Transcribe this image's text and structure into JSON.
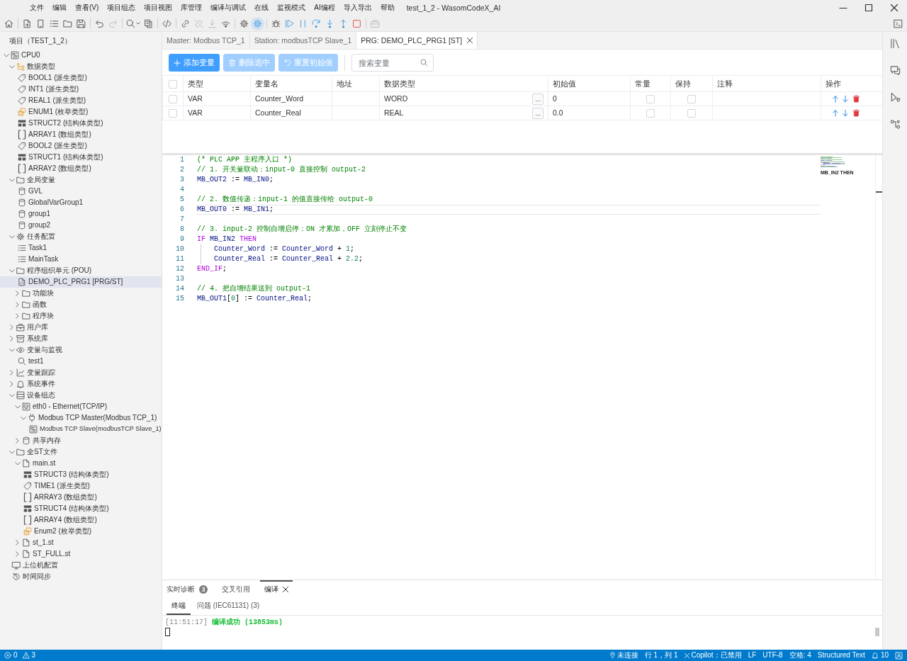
{
  "window": {
    "title": "test_1_2 - WasomCodeX_AI"
  },
  "menu": [
    "文件",
    "编辑",
    "查看(V)",
    "项目组态",
    "项目视图",
    "库管理",
    "编译与调试",
    "在线",
    "监视模式",
    "AI编程",
    "导入导出",
    "帮助"
  ],
  "toolbar": [
    {
      "kind": "home",
      "disabled": false,
      "active": false
    },
    {
      "kind": "separator"
    },
    {
      "kind": "new",
      "disabled": false,
      "active": false
    },
    {
      "kind": "device",
      "disabled": false,
      "active": false
    },
    {
      "kind": "list",
      "disabled": false,
      "active": false
    },
    {
      "kind": "open",
      "disabled": false,
      "active": false
    },
    {
      "kind": "save",
      "disabled": false,
      "active": false
    },
    {
      "kind": "separator"
    },
    {
      "kind": "undo",
      "disabled": false,
      "active": false
    },
    {
      "kind": "redo",
      "disabled": true,
      "active": false
    },
    {
      "kind": "separator"
    },
    {
      "kind": "find",
      "disabled": false,
      "active": false
    },
    {
      "kind": "board",
      "disabled": false,
      "active": false
    },
    {
      "kind": "separator"
    },
    {
      "kind": "code",
      "disabled": false,
      "active": false
    },
    {
      "kind": "separator"
    },
    {
      "kind": "connect",
      "disabled": false,
      "active": false
    },
    {
      "kind": "disconnect",
      "disabled": true,
      "active": false
    },
    {
      "kind": "download",
      "disabled": true,
      "active": false
    },
    {
      "kind": "monitor",
      "disabled": false,
      "active": false
    },
    {
      "kind": "separator"
    },
    {
      "kind": "settings",
      "disabled": false,
      "active": false
    },
    {
      "kind": "simulate",
      "disabled": false,
      "active": true
    },
    {
      "kind": "separator"
    },
    {
      "kind": "debug",
      "disabled": false,
      "active": false
    },
    {
      "kind": "run",
      "disabled": false,
      "active": false
    },
    {
      "kind": "pause",
      "disabled": false,
      "active": false
    },
    {
      "kind": "stepover",
      "disabled": false,
      "active": false
    },
    {
      "kind": "stepinto",
      "disabled": false,
      "active": false
    },
    {
      "kind": "stepout",
      "disabled": false,
      "active": false
    },
    {
      "kind": "stop",
      "disabled": false,
      "active": false
    },
    {
      "kind": "separator"
    },
    {
      "kind": "package",
      "disabled": true,
      "active": false
    },
    {
      "kind": "spacer"
    },
    {
      "kind": "terminal",
      "disabled": false,
      "active": false
    }
  ],
  "sidebar": {
    "title": "项目（TEST_1_2）",
    "tree": [
      {
        "label": "CPU0",
        "kind": "cpu",
        "expanded": true,
        "selected": false,
        "children": [
          {
            "label": "数据类型",
            "kind": "datatypes",
            "expanded": true,
            "selected": false,
            "children": [
              {
                "label": "BOOL1 (派生类型)",
                "kind": "derived",
                "selected": false
              },
              {
                "label": "INT1 (派生类型)",
                "kind": "derived",
                "selected": false
              },
              {
                "label": "REAL1 (派生类型)",
                "kind": "derived",
                "selected": false
              },
              {
                "label": "ENUM1 (枚举类型)",
                "kind": "enum",
                "selected": false
              },
              {
                "label": "STRUCT2 (结构体类型)",
                "kind": "struct",
                "selected": false
              },
              {
                "label": "ARRAY1 (数组类型)",
                "kind": "array",
                "selected": false
              },
              {
                "label": "BOOL2 (派生类型)",
                "kind": "derived",
                "selected": false
              },
              {
                "label": "STRUCT1 (结构体类型)",
                "kind": "struct",
                "selected": false
              },
              {
                "label": "ARRAY2 (数组类型)",
                "kind": "array",
                "selected": false
              }
            ]
          },
          {
            "label": "全局变量",
            "kind": "folder",
            "expanded": true,
            "selected": false,
            "children": [
              {
                "label": "GVL",
                "kind": "varlist",
                "selected": false
              },
              {
                "label": "GlobalVarGroup1",
                "kind": "varlist",
                "selected": false
              },
              {
                "label": "group1",
                "kind": "varlist",
                "selected": false
              },
              {
                "label": "group2",
                "kind": "varlist",
                "selected": false
              }
            ]
          },
          {
            "label": "任务配置",
            "kind": "tasks",
            "expanded": true,
            "selected": false,
            "children": [
              {
                "label": "Task1",
                "kind": "task",
                "selected": false
              },
              {
                "label": "MainTask",
                "kind": "task",
                "selected": false
              }
            ]
          },
          {
            "label": "程序组织单元 (POU)",
            "kind": "folder",
            "expanded": true,
            "selected": false,
            "children": [
              {
                "label": "DEMO_PLC_PRG1 [PRG/ST]",
                "kind": "program",
                "selected": true
              },
              {
                "label": "功能块",
                "kind": "folder",
                "expanded": false,
                "selected": false
              },
              {
                "label": "函数",
                "kind": "folder",
                "expanded": false,
                "selected": false
              },
              {
                "label": "程序块",
                "kind": "folder",
                "expanded": false,
                "selected": false
              }
            ]
          },
          {
            "label": "用户库",
            "kind": "userlib",
            "expanded": false,
            "selected": false
          },
          {
            "label": "系统库",
            "kind": "syslib",
            "expanded": false,
            "selected": false
          },
          {
            "label": "变量与监视",
            "kind": "watch",
            "expanded": true,
            "selected": false,
            "children": [
              {
                "label": "test1",
                "kind": "watchlist",
                "selected": false
              }
            ]
          },
          {
            "label": "变量跟踪",
            "kind": "trace",
            "expanded": false,
            "selected": false
          },
          {
            "label": "系统事件",
            "kind": "events",
            "expanded": false,
            "selected": false
          },
          {
            "label": "设备组态",
            "kind": "devices",
            "expanded": true,
            "selected": false,
            "children": [
              {
                "label": "eth0 - Ethernet(TCP/IP)",
                "kind": "ethernet",
                "expanded": true,
                "selected": false,
                "children": [
                  {
                    "label": "Modbus TCP Master(Modbus TCP_1)",
                    "kind": "master",
                    "expanded": true,
                    "selected": false,
                    "children": [
                      {
                        "label": "Modbus TCP Slave(modbusTCP Slave_1)",
                        "kind": "slave",
                        "selected": false
                      }
                    ]
                  }
                ]
              },
              {
                "label": "共享内存",
                "kind": "memory",
                "expanded": false,
                "selected": false
              }
            ]
          },
          {
            "label": "全ST文件",
            "kind": "folder",
            "expanded": true,
            "selected": false,
            "children": [
              {
                "label": "main.st",
                "kind": "stfile",
                "expanded": true,
                "selected": false,
                "children": [
                  {
                    "label": "STRUCT3 (结构体类型)",
                    "kind": "struct",
                    "selected": false
                  },
                  {
                    "label": "TIME1 (派生类型)",
                    "kind": "derived",
                    "selected": false
                  },
                  {
                    "label": "ARRAY3 (数组类型)",
                    "kind": "array",
                    "selected": false
                  },
                  {
                    "label": "STRUCT4 (结构体类型)",
                    "kind": "struct",
                    "selected": false
                  },
                  {
                    "label": "ARRAY4 (数组类型)",
                    "kind": "array",
                    "selected": false
                  },
                  {
                    "label": "Enum2 (枚举类型)",
                    "kind": "enum",
                    "selected": false
                  }
                ]
              },
              {
                "label": "st_1.st",
                "kind": "stfile",
                "expanded": false,
                "selected": false
              },
              {
                "label": "ST_FULL.st",
                "kind": "stfile",
                "expanded": false,
                "selected": false
              }
            ]
          },
          {
            "label": "上位机配置",
            "kind": "host",
            "selected": false
          },
          {
            "label": "时间同步",
            "kind": "timesync",
            "selected": false
          }
        ]
      }
    ]
  },
  "tabs": [
    {
      "label": "Master: Modbus TCP_1",
      "selected": false
    },
    {
      "label": "Station: modbusTCP Slave_1",
      "selected": false
    },
    {
      "label": "PRG: DEMO_PLC_PRG1 [ST]",
      "selected": true
    }
  ],
  "variables": {
    "buttons": [
      {
        "kind": "add",
        "label": "添加变量",
        "disabled": false
      },
      {
        "kind": "delete",
        "label": "删除选中",
        "disabled": true
      },
      {
        "kind": "reset",
        "label": "重置初始值",
        "disabled": true
      }
    ],
    "search": {
      "placeholder": "搜索变量"
    },
    "table": {
      "all_selected": false,
      "columns": [
        "类型",
        "变量名",
        "地址",
        "数据类型",
        "初始值",
        "常量",
        "保持",
        "注释",
        "操作"
      ],
      "rows": [
        {
          "selected": false,
          "type": "VAR",
          "name": "Counter_Word",
          "data_type": "WORD",
          "type_button": "...",
          "initial_value": "0",
          "constant": false,
          "retain": false
        },
        {
          "selected": false,
          "type": "VAR",
          "name": "Counter_Real",
          "data_type": "REAL",
          "type_button": "...",
          "initial_value": "0.0",
          "constant": false,
          "retain": false
        }
      ]
    }
  },
  "editor": {
    "lines": [
      {
        "number": "1",
        "current": false,
        "tokens": [
          {
            "kind": "comment",
            "text": "(* PLC APP 主程序入口 *)"
          }
        ]
      },
      {
        "number": "2",
        "current": false,
        "tokens": [
          {
            "kind": "comment",
            "text": "// 1. 开关量联动：input-0 直接控制 output-2"
          }
        ]
      },
      {
        "number": "3",
        "current": false,
        "tokens": [
          {
            "kind": "ident",
            "text": "MB_OUT2"
          },
          {
            "kind": "plain",
            "text": " := "
          },
          {
            "kind": "ident",
            "text": "MB_IN0"
          },
          {
            "kind": "plain",
            "text": ";"
          }
        ]
      },
      {
        "number": "4",
        "current": false
      },
      {
        "number": "5",
        "current": false,
        "tokens": [
          {
            "kind": "comment",
            "text": "// 2. 数值传递：input-1 的值直接传给 output-0"
          }
        ]
      },
      {
        "number": "6",
        "current": true,
        "tokens": [
          {
            "kind": "ident",
            "text": "MB_OUT0"
          },
          {
            "kind": "plain",
            "text": " := "
          },
          {
            "kind": "ident",
            "text": "MB_IN1"
          },
          {
            "kind": "plain",
            "text": ";"
          }
        ]
      },
      {
        "number": "7",
        "current": false
      },
      {
        "number": "8",
        "current": false,
        "tokens": [
          {
            "kind": "comment",
            "text": "// 3. input-2 控制自增启停：ON 才累加，OFF 立刻停止不变"
          }
        ]
      },
      {
        "number": "9",
        "current": false,
        "tokens": [
          {
            "kind": "keyword",
            "text": "IF "
          },
          {
            "kind": "ident",
            "text": "MB_IN2 "
          },
          {
            "kind": "keyword",
            "text": "THEN"
          }
        ]
      },
      {
        "number": "10",
        "current": false,
        "tokens": [
          {
            "kind": "ident",
            "text": "    Counter_Word"
          },
          {
            "kind": "plain",
            "text": " := "
          },
          {
            "kind": "ident",
            "text": "Counter_Word"
          },
          {
            "kind": "plain",
            "text": " + "
          },
          {
            "kind": "number",
            "text": "1"
          },
          {
            "kind": "plain",
            "text": ";"
          }
        ]
      },
      {
        "number": "11",
        "current": false,
        "tokens": [
          {
            "kind": "ident",
            "text": "    Counter_Real"
          },
          {
            "kind": "plain",
            "text": " := "
          },
          {
            "kind": "ident",
            "text": "Counter_Real"
          },
          {
            "kind": "plain",
            "text": " + "
          },
          {
            "kind": "number",
            "text": "2.2"
          },
          {
            "kind": "plain",
            "text": ";"
          }
        ]
      },
      {
        "number": "12",
        "current": false,
        "tokens": [
          {
            "kind": "keyword",
            "text": "END_IF"
          },
          {
            "kind": "plain",
            "text": ";"
          }
        ]
      },
      {
        "number": "13",
        "current": false
      },
      {
        "number": "14",
        "current": false,
        "tokens": [
          {
            "kind": "comment",
            "text": "// 4. 把自增结果送到 output-1"
          }
        ]
      },
      {
        "number": "15",
        "current": false,
        "tokens": [
          {
            "kind": "ident",
            "text": "MB_OUT1"
          },
          {
            "kind": "plain",
            "text": "["
          },
          {
            "kind": "number",
            "text": "0"
          },
          {
            "kind": "plain",
            "text": "] := "
          },
          {
            "kind": "ident",
            "text": "Counter_Real"
          },
          {
            "kind": "plain",
            "text": ";"
          }
        ]
      }
    ],
    "minimap_label": "MB_IN2 THEN"
  },
  "panel": {
    "tabs": [
      {
        "label": "实时诊断",
        "badge": "3",
        "selected": false
      },
      {
        "label": "交叉引用",
        "selected": false
      },
      {
        "label": "编译",
        "selected": true
      }
    ],
    "subtabs": [
      {
        "label": "终端",
        "selected": true
      },
      {
        "label": "问题 (IEC61131) (3)",
        "selected": false
      }
    ],
    "terminal": [
      {
        "time": "[11:51:17]",
        "message": "编译成功 (13853ms)"
      }
    ]
  },
  "status_bar": {
    "left": [
      {
        "kind": "errors",
        "text": "0"
      },
      {
        "kind": "warnings",
        "text": "3"
      }
    ],
    "right": [
      {
        "kind": "connection",
        "text": "未连接"
      },
      {
        "kind": "text",
        "text": "行 1，列 1"
      },
      {
        "kind": "copilot",
        "text": "Copilot：已禁用"
      },
      {
        "kind": "text",
        "text": "LF"
      },
      {
        "kind": "text",
        "text": "UTF-8"
      },
      {
        "kind": "text",
        "text": "空格: 4"
      },
      {
        "kind": "text",
        "text": "Structured Text"
      },
      {
        "kind": "notifications",
        "text": "10"
      },
      {
        "kind": "feedback"
      }
    ]
  }
}
